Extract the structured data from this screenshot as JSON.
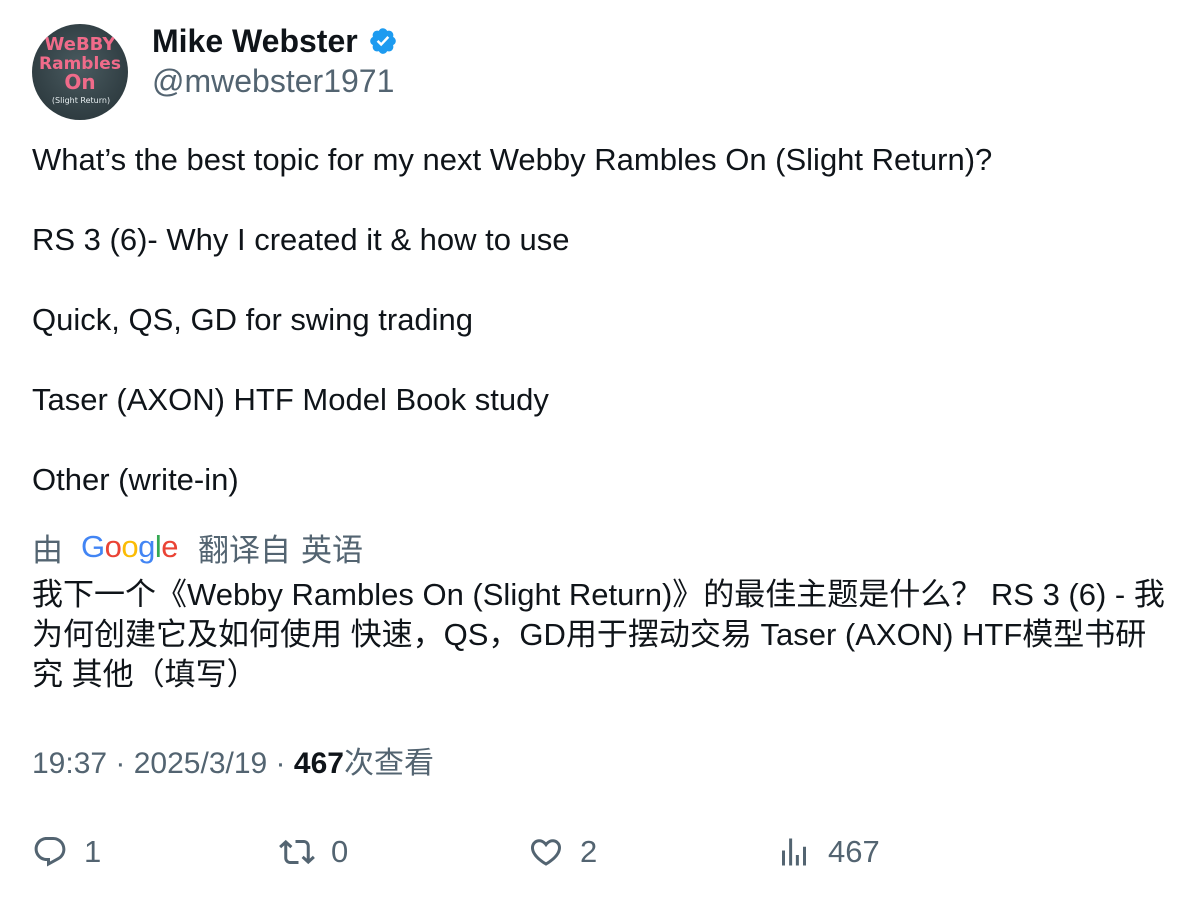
{
  "author": {
    "name": "Mike Webster",
    "handle": "@mwebster1971",
    "avatar_text": [
      "WeBBY",
      "Rambles",
      "On",
      "(Slight Return)"
    ]
  },
  "tweet": {
    "lines": [
      "What’s the best topic for my next Webby Rambles On (Slight Return)?",
      "RS 3 (6)- Why I created it & how to use",
      "Quick, QS, GD for swing trading",
      "Taser (AXON) HTF Model Book study",
      "Other (write-in)"
    ]
  },
  "translation": {
    "by_label": "由",
    "provider": "Google",
    "from_label": "翻译自",
    "language": "英语",
    "text": "我下一个《Webby Rambles On (Slight Return)》的最佳主题是什么？ RS 3 (6) - 我为何创建它及如何使用 快速，QS，GD用于摆动交易 Taser (AXON) HTF模型书研究 其他（填写）"
  },
  "meta": {
    "time": "19:37",
    "separator": " · ",
    "date": "2025/3/19",
    "views_count": "467",
    "views_label": "次查看"
  },
  "actions": {
    "replies": "1",
    "retweets": "0",
    "likes": "2",
    "views": "467"
  },
  "colors": {
    "text_primary": "#0f1419",
    "text_secondary": "#536471",
    "verified_blue": "#1d9bf0",
    "avatar_pink": "#f06b8a"
  }
}
